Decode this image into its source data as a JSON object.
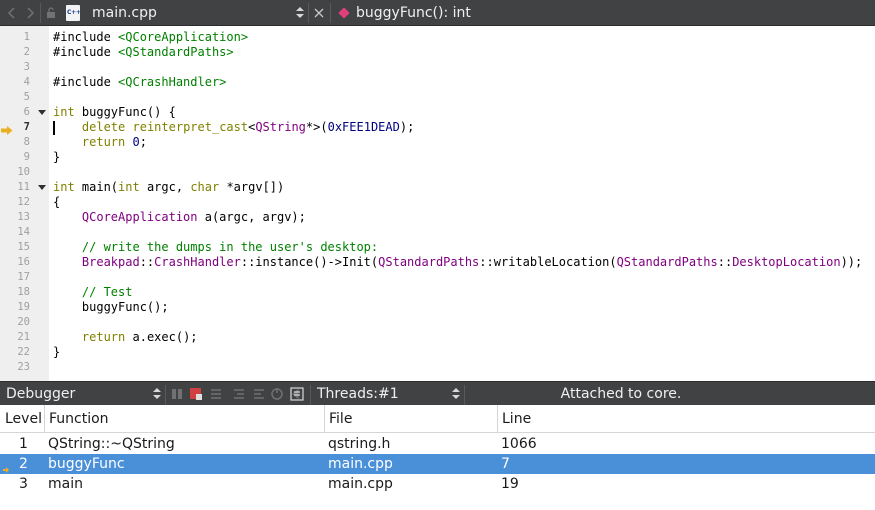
{
  "editor_toolbar": {
    "file_name": "main.cpp",
    "symbol": "buggyFunc(): int",
    "icons": [
      "back-arrow-icon",
      "forward-arrow-icon",
      "lock-icon",
      "cpp-file-icon",
      "updown-icon",
      "close-icon",
      "function-diamond-icon"
    ]
  },
  "editor": {
    "current_line": 7,
    "lines": [
      {
        "num": "1",
        "tokens": [
          {
            "t": "#include ",
            "c": "def"
          },
          {
            "t": "<QCoreApplication>",
            "c": "str"
          }
        ]
      },
      {
        "num": "2",
        "tokens": [
          {
            "t": "#include ",
            "c": "def"
          },
          {
            "t": "<QStandardPaths>",
            "c": "str"
          }
        ]
      },
      {
        "num": "3",
        "tokens": []
      },
      {
        "num": "4",
        "tokens": [
          {
            "t": "#include ",
            "c": "def"
          },
          {
            "t": "<QCrashHandler>",
            "c": "str"
          }
        ]
      },
      {
        "num": "5",
        "tokens": []
      },
      {
        "num": "6",
        "fold": true,
        "tokens": [
          {
            "t": "int",
            "c": "kw"
          },
          {
            "t": " buggyFunc() {",
            "c": "def"
          }
        ]
      },
      {
        "num": "7",
        "tokens": [
          {
            "t": "    ",
            "c": "def"
          },
          {
            "t": "delete",
            "c": "kw"
          },
          {
            "t": " ",
            "c": "def"
          },
          {
            "t": "reinterpret_cast",
            "c": "kw"
          },
          {
            "t": "<",
            "c": "def"
          },
          {
            "t": "QString",
            "c": "type"
          },
          {
            "t": "*>(",
            "c": "def"
          },
          {
            "t": "0xFEE1DEAD",
            "c": "num"
          },
          {
            "t": ");",
            "c": "def"
          }
        ]
      },
      {
        "num": "8",
        "tokens": [
          {
            "t": "    ",
            "c": "def"
          },
          {
            "t": "return",
            "c": "kw"
          },
          {
            "t": " ",
            "c": "def"
          },
          {
            "t": "0",
            "c": "num"
          },
          {
            "t": ";",
            "c": "def"
          }
        ]
      },
      {
        "num": "9",
        "tokens": [
          {
            "t": "}",
            "c": "def"
          }
        ]
      },
      {
        "num": "10",
        "tokens": []
      },
      {
        "num": "11",
        "fold": true,
        "tokens": [
          {
            "t": "int",
            "c": "kw"
          },
          {
            "t": " main(",
            "c": "def"
          },
          {
            "t": "int",
            "c": "kw"
          },
          {
            "t": " argc, ",
            "c": "def"
          },
          {
            "t": "char",
            "c": "kw"
          },
          {
            "t": " *argv[])",
            "c": "def"
          }
        ]
      },
      {
        "num": "12",
        "tokens": [
          {
            "t": "{",
            "c": "def"
          }
        ]
      },
      {
        "num": "13",
        "tokens": [
          {
            "t": "    ",
            "c": "def"
          },
          {
            "t": "QCoreApplication",
            "c": "type"
          },
          {
            "t": " a(argc, argv);",
            "c": "def"
          }
        ]
      },
      {
        "num": "14",
        "tokens": []
      },
      {
        "num": "15",
        "tokens": [
          {
            "t": "    ",
            "c": "def"
          },
          {
            "t": "// write the dumps in the user's desktop:",
            "c": "com"
          }
        ]
      },
      {
        "num": "16",
        "tokens": [
          {
            "t": "    ",
            "c": "def"
          },
          {
            "t": "Breakpad",
            "c": "type"
          },
          {
            "t": "::",
            "c": "def"
          },
          {
            "t": "CrashHandler",
            "c": "type"
          },
          {
            "t": "::instance()->Init(",
            "c": "def"
          },
          {
            "t": "QStandardPaths",
            "c": "type"
          },
          {
            "t": "::writableLocation(",
            "c": "def"
          },
          {
            "t": "QStandardPaths",
            "c": "type"
          },
          {
            "t": "::",
            "c": "def"
          },
          {
            "t": "DesktopLocation",
            "c": "type"
          },
          {
            "t": "));",
            "c": "def"
          }
        ]
      },
      {
        "num": "17",
        "tokens": []
      },
      {
        "num": "18",
        "tokens": [
          {
            "t": "    ",
            "c": "def"
          },
          {
            "t": "// Test",
            "c": "com"
          }
        ]
      },
      {
        "num": "19",
        "tokens": [
          {
            "t": "    buggyFunc();",
            "c": "def"
          }
        ]
      },
      {
        "num": "20",
        "tokens": []
      },
      {
        "num": "21",
        "tokens": [
          {
            "t": "    ",
            "c": "def"
          },
          {
            "t": "return",
            "c": "kw"
          },
          {
            "t": " a.exec();",
            "c": "def"
          }
        ]
      },
      {
        "num": "22",
        "tokens": [
          {
            "t": "}",
            "c": "def"
          }
        ]
      },
      {
        "num": "23",
        "tokens": []
      }
    ]
  },
  "debugger_bar": {
    "engine": "Debugger",
    "threads_label": "Threads:",
    "thread_value": "#1",
    "status": "Attached to core.",
    "icons": [
      "continue-icon",
      "stop-icon",
      "step-over-icon",
      "step-into-icon",
      "step-out-icon",
      "restart-icon",
      "reverse-icon",
      "operate-by-instruction-icon"
    ]
  },
  "stack": {
    "columns": [
      "Level",
      "Function",
      "File",
      "Line"
    ],
    "rows": [
      {
        "level": "1",
        "function": "QString::~QString",
        "file": "qstring.h",
        "line": "1066",
        "current": false
      },
      {
        "level": "2",
        "function": "buggyFunc",
        "file": "main.cpp",
        "line": "7",
        "current": true
      },
      {
        "level": "3",
        "function": "main",
        "file": "main.cpp",
        "line": "19",
        "current": false
      }
    ]
  },
  "colors": {
    "toolbar": "#404244",
    "selection": "#4a90d9",
    "keyword": "#808000",
    "string": "#008000",
    "type": "#800080",
    "number": "#000080",
    "marker": "#e8b020"
  }
}
